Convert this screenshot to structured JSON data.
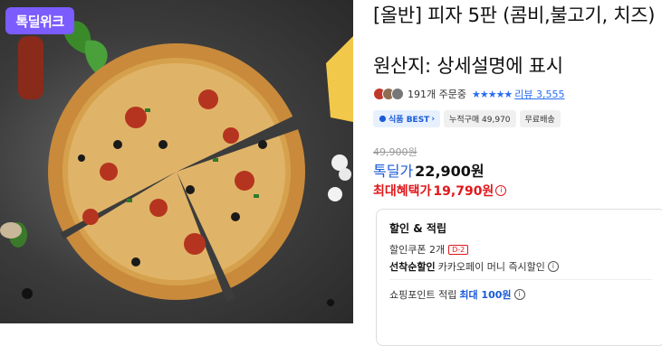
{
  "image_badge": {
    "text": "톡딜위크"
  },
  "product": {
    "title": "[올반] 피자 5판 (콤비,불고기, 치즈)",
    "origin": "원산지: 상세설명에 표시"
  },
  "social": {
    "orders_text": "191개 주문중",
    "stars": "★★★★★",
    "review_label": "리뷰 3,555"
  },
  "chips": [
    {
      "label": "식품 BEST",
      "arrow": "›"
    },
    {
      "label": "누적구매 49,970"
    },
    {
      "label": "무료배송"
    }
  ],
  "price": {
    "original": "49,900원",
    "deal_label": "톡딜가",
    "deal_price": "22,900원",
    "max_label": "최대혜택가",
    "max_price": "19,790원"
  },
  "benefits": {
    "title": "할인 & 적립",
    "coupon_text": "할인쿠폰 2개",
    "coupon_badge": "D-2",
    "first_bold": "선착순할인",
    "first_text": "카카오페이 머니 즉시할인",
    "point_text": "쇼핑포인트 적립",
    "point_highlight": "최대 100원"
  },
  "icons": {
    "info": "info-icon",
    "food": "food-icon"
  },
  "colors": {
    "accent_blue": "#2a6df4",
    "deal_blue": "#1b5bd8",
    "red": "#e0181b",
    "badge_purple": "#7b5cff"
  }
}
